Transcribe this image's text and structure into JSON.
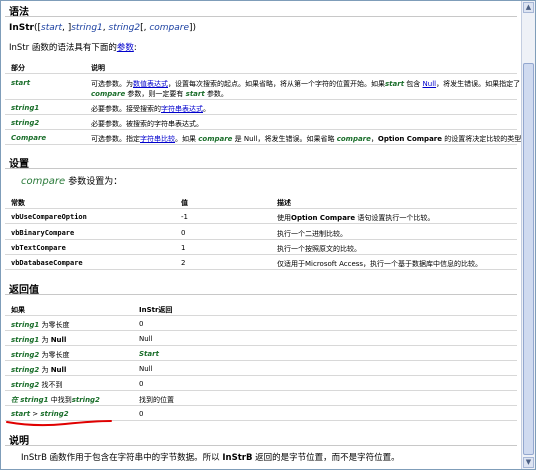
{
  "syntax": {
    "heading": "语法",
    "signature": {
      "func": "InStr",
      "open": "([",
      "start": "start",
      "sep1": ", ]",
      "string1": "string1",
      "sep2": ", ",
      "string2": "string2",
      "sep3": "[, ",
      "compare": "compare",
      "close": "])"
    },
    "intro_prefix": "InStr 函数的语法具有下面的",
    "intro_link": "参数",
    "intro_suffix": ":",
    "table": {
      "col_part": "部分",
      "col_desc": "说明",
      "rows": [
        {
          "part": "start",
          "desc_a": "可选参数。为",
          "desc_link": "数值表达式",
          "desc_b": "，设置每次搜索的起点。如果省略，将从第一个字符的位置开始。如果",
          "desc_it": "start",
          "desc_c": "包含",
          "desc_link2": "Null",
          "desc_d": "，将发生错误。如果指定了",
          "line2_it": "compare",
          "line2_a": "参数，则一定要有",
          "line2_it2": "start",
          "line2_b": "参数。"
        },
        {
          "part": "string1",
          "desc_a": "必要参数。接受搜索的",
          "desc_link": "字符串表达式",
          "desc_b": "。"
        },
        {
          "part": "string2",
          "desc_a": "必要参数。被搜索的字符串表达式。"
        },
        {
          "part": "Compare",
          "desc_a": "可选参数。指定",
          "desc_link": "字符串比较",
          "desc_b": "。如果",
          "desc_it": "compare",
          "desc_c": "是 Null，将发生错误。如果省略",
          "desc_it2": "compare",
          "desc_d": "，",
          "desc_bold": "Option Compare",
          "desc_e": "的设置将决定比较的类型。"
        }
      ]
    }
  },
  "settings": {
    "heading": "设置",
    "sub_it": "compare",
    "sub_text": "参数设置为：",
    "table": {
      "col_const": "常数",
      "col_value": "值",
      "col_desc": "描述",
      "rows": [
        {
          "const": "vbUseCompareOption",
          "value": "-1",
          "desc_a": "使用",
          "desc_bold": "Option Compare",
          "desc_b": "语句设置执行一个比较。"
        },
        {
          "const": "vbBinaryCompare",
          "value": "0",
          "desc_a": "执行一个二进制比较。"
        },
        {
          "const": "vbTextCompare",
          "value": "1",
          "desc_a": "执行一个按照原文的比较。"
        },
        {
          "const": "vbDatabaseCompare",
          "value": "2",
          "desc_a": "仅适用于Microsoft Access，执行一个基于数据库中信息的比较。"
        }
      ]
    }
  },
  "returns": {
    "heading": "返回值",
    "table": {
      "col_if": "如果",
      "col_ret": "InStr返回",
      "rows": [
        {
          "if_it": "string1",
          "if_text": "为零长度",
          "ret": "0"
        },
        {
          "if_it": "string1",
          "if_text": "为",
          "if_bold": "Null",
          "ret": "Null"
        },
        {
          "if_it": "string2",
          "if_text": "为零长度",
          "ret": "Start",
          "ret_it": true
        },
        {
          "if_it": "string2",
          "if_text": "为",
          "if_bold": "Null",
          "ret": "Null"
        },
        {
          "if_it": "string2",
          "if_text": "找不到",
          "ret": "0"
        },
        {
          "if_pre": "在",
          "if_it": "string1",
          "if_text": "中找到",
          "if_it2": "string2",
          "ret": "找到的位置"
        },
        {
          "if_it": "start",
          "if_text": ">",
          "if_it2": "string2",
          "ret": "0"
        }
      ]
    }
  },
  "remarks": {
    "heading": "说明",
    "text_a": "InStrB 函数作用于包含在字符串中的字节数据。所以",
    "text_bold1": "InStrB",
    "text_b": "返回的是字节位置，而不是字符位置。"
  },
  "colors": {
    "param": "#1a6e2a",
    "link": "#0000cc",
    "annotation": "#e00000"
  }
}
